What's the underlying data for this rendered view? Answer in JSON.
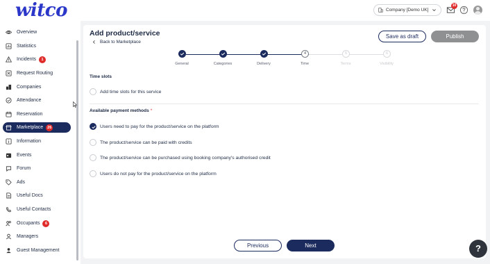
{
  "app": {
    "logo": "witco"
  },
  "topbar": {
    "company": "Company [Demo UK]",
    "mail_count": "10",
    "icons": [
      "building-icon",
      "chevron-down-icon",
      "mail-icon",
      "help-circle-icon",
      "avatar"
    ]
  },
  "sidebar": {
    "items": [
      {
        "label": "Overview",
        "icon": "eye-icon"
      },
      {
        "label": "Statistics",
        "icon": "chart-icon"
      },
      {
        "label": "Incidents",
        "icon": "warning-icon",
        "badge": "1"
      },
      {
        "label": "Request Routing",
        "icon": "routing-icon"
      },
      {
        "label": "Companies",
        "icon": "companies-icon"
      },
      {
        "label": "Attendance",
        "icon": "check-circle-icon"
      },
      {
        "label": "Reservation",
        "icon": "calendar-icon"
      },
      {
        "label": "Marketplace",
        "icon": "store-icon",
        "badge": "26",
        "active": true
      },
      {
        "label": "Information",
        "icon": "info-icon"
      },
      {
        "label": "Events",
        "icon": "events-icon"
      },
      {
        "label": "Forum",
        "icon": "chat-icon"
      },
      {
        "label": "Ads",
        "icon": "tag-icon"
      },
      {
        "label": "Useful Docs",
        "icon": "document-icon"
      },
      {
        "label": "Useful Contacts",
        "icon": "contacts-icon"
      },
      {
        "label": "Occupants",
        "icon": "users-icon",
        "badge": "6"
      },
      {
        "label": "Managers",
        "icon": "user-icon"
      },
      {
        "label": "Guest Management",
        "icon": "guest-icon"
      }
    ]
  },
  "page": {
    "title": "Add product/service",
    "back_label": "Back to Marketplace",
    "save_draft": "Save as draft",
    "publish": "Publish"
  },
  "stepper": {
    "steps": [
      {
        "label": "General",
        "state": "done"
      },
      {
        "label": "Categories",
        "state": "done"
      },
      {
        "label": "Delivery",
        "state": "done"
      },
      {
        "label": "Time",
        "state": "current",
        "number": "4"
      },
      {
        "label": "Terms",
        "state": "future",
        "number": "5"
      },
      {
        "label": "Visibility",
        "state": "future",
        "number": "6"
      }
    ]
  },
  "time_slots": {
    "label": "Time slots",
    "option": "Add time slots for this service"
  },
  "payment": {
    "label": "Available payment methods",
    "required_mark": "*",
    "options": [
      {
        "label": "Users need to pay for the product/service on the platform",
        "checked": true
      },
      {
        "label": "The product/service can be paid with credits",
        "checked": false
      },
      {
        "label": "The product/service can be purchased using booking company's authorised credit",
        "checked": false
      },
      {
        "label": "Users do not pay for the product/service on the platform",
        "checked": false
      }
    ]
  },
  "footer": {
    "previous": "Previous",
    "next": "Next"
  },
  "help_button": "?",
  "colors": {
    "brand": "#2b37c9",
    "navy": "#1b2b5e",
    "badge": "#e02b2b",
    "disabled": "#8f9092"
  }
}
